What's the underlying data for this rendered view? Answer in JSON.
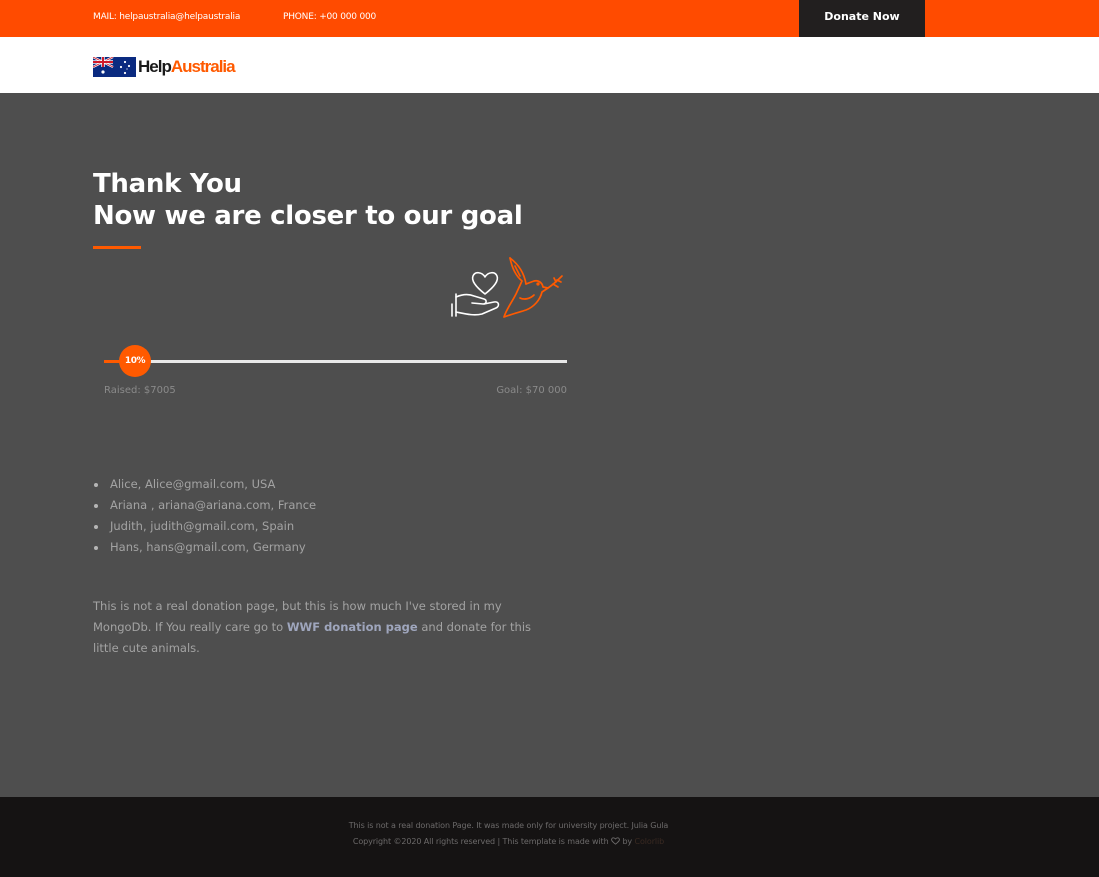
{
  "topbar": {
    "mail": "MAIL: helpaustralia@helpaustralia",
    "phone": "PHONE: +00 000 000",
    "donate_label": "Donate Now"
  },
  "brand": {
    "part1": "Help",
    "part2": "Australia",
    "flag_icon": "australia-flag-icon",
    "color_accent": "#ff5a00"
  },
  "hero": {
    "title_line1": "Thank You",
    "title_line2": "Now we are closer to our goal"
  },
  "progress": {
    "percent_label": "10%",
    "percent": 10,
    "raised": "Raised: $7005",
    "goal": "Goal: $70 000"
  },
  "donors": [
    "Alice, Alice@gmail.com, USA",
    "Ariana , ariana@ariana.com, France",
    "Judith, judith@gmail.com, Spain",
    "Hans, hans@gmail.com, Germany"
  ],
  "note": {
    "before": "This is not a real donation page, but this is how much I've stored in my MongoDb. If You really care go to ",
    "link": "WWF donation page",
    "after": " and donate for this little cute animals."
  },
  "footer": {
    "line1": "This is not a real donation Page. It was made only for university project. Julia Gula",
    "line2_before": "Copyright ©2020 All rights reserved | This template is made with ",
    "line2_by": " by ",
    "line2_link": "Colorlib"
  },
  "colors": {
    "topbar": "#ff4b00",
    "hero_bg": "#4e4e4e",
    "footer_bg": "#151313"
  },
  "icons": [
    "australia-flag-icon",
    "hand-heart-icon",
    "dove-icon",
    "heart-icon"
  ]
}
